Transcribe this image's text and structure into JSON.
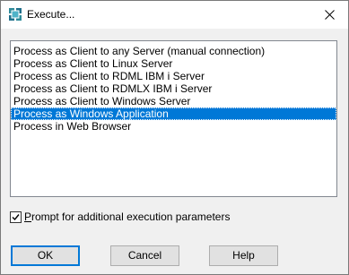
{
  "window": {
    "title": "Execute...",
    "icon": "execute-app-icon",
    "close_icon": "close-icon"
  },
  "list": {
    "items": [
      "Process as Client to any Server (manual connection)",
      "Process as Client to Linux Server",
      "Process as Client to RDML IBM i Server",
      "Process as Client to RDMLX IBM i Server",
      "Process as Client to Windows Server",
      "Process as Windows Application",
      "Process in Web Browser"
    ],
    "selected_index": 5,
    "selected_value": "Process as Windows Application"
  },
  "prompt_option": {
    "mnemonic": "P",
    "label_rest": "rompt for additional execution parameters",
    "checked": true
  },
  "buttons": {
    "ok": "OK",
    "cancel": "Cancel",
    "help": "Help"
  },
  "colors": {
    "selection": "#0078d7",
    "dialog_background": "#f0f0f0",
    "button_face": "#e1e1e1",
    "default_button_border": "#0078d7"
  }
}
